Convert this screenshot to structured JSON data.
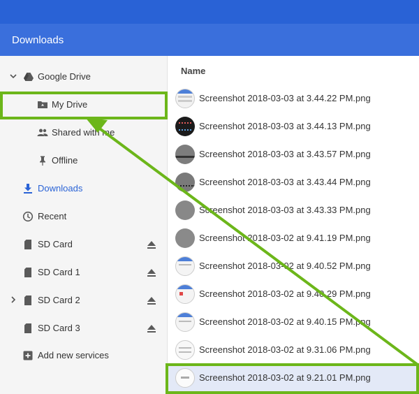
{
  "window": {
    "title": "Downloads"
  },
  "sidebar": {
    "google_drive": "Google Drive",
    "my_drive": "My Drive",
    "shared_with_me": "Shared with me",
    "offline": "Offline",
    "downloads": "Downloads",
    "recent": "Recent",
    "sd_card": "SD Card",
    "sd_card_1": "SD Card 1",
    "sd_card_2": "SD Card 2",
    "sd_card_3": "SD Card 3",
    "add_new_services": "Add new services"
  },
  "files": {
    "column_name": "Name",
    "items": [
      "Screenshot 2018-03-03 at 3.44.22 PM.png",
      "Screenshot 2018-03-03 at 3.44.13 PM.png",
      "Screenshot 2018-03-03 at 3.43.57 PM.png",
      "Screenshot 2018-03-03 at 3.43.44 PM.png",
      "Screenshot 2018-03-03 at 3.43.33 PM.png",
      "Screenshot 2018-03-02 at 9.41.19 PM.png",
      "Screenshot 2018-03-02 at 9.40.52 PM.png",
      "Screenshot 2018-03-02 at 9.40.29 PM.png",
      "Screenshot 2018-03-02 at 9.40.15 PM.png",
      "Screenshot 2018-03-02 at 9.31.06 PM.png",
      "Screenshot 2018-03-02 at 9.21.01 PM.png"
    ]
  },
  "colors": {
    "accent": "#3a6fdc",
    "top_bar": "#2962d6",
    "annotation_green": "#6cb61a",
    "selected_row": "#e3e9f7"
  }
}
